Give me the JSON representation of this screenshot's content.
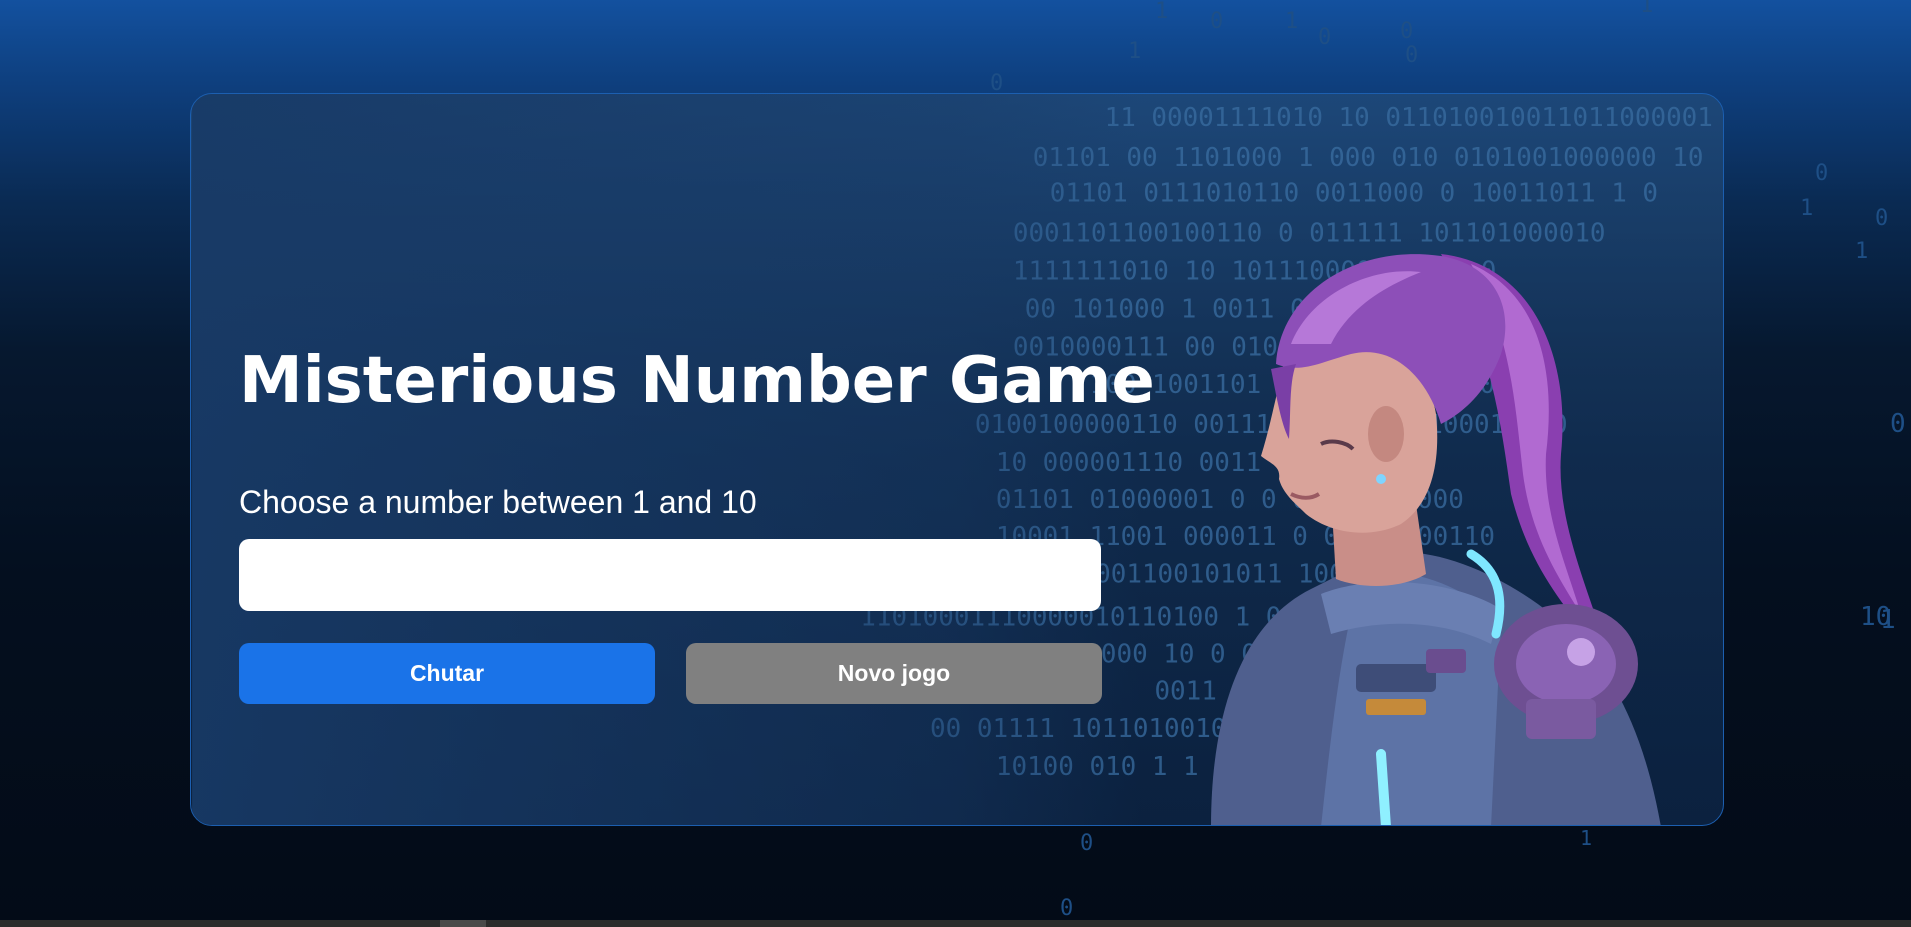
{
  "game": {
    "title": "Misterious Number Game",
    "prompt": "Choose a number between 1 and 10",
    "guess_value": "",
    "guess_placeholder": "",
    "guess_button_label": "Chutar",
    "new_game_button_label": "Novo jogo"
  },
  "illustration": {
    "subject": "woman-astronaut-portrait",
    "hair_color": "#a45cc7",
    "suit_color": "#5a6f9a",
    "accent_glow": "#7fe7ff"
  },
  "colors": {
    "primary_button": "#1a73e8",
    "secondary_button": "#808080",
    "card_border": "#1c5fb0",
    "background_top": "#13519f",
    "background_bottom": "#030b17"
  }
}
